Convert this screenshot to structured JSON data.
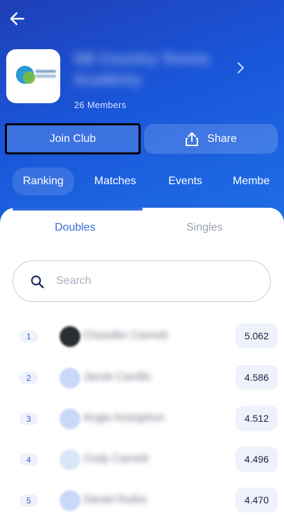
{
  "header": {
    "back_icon": "arrow-left-icon",
    "club_name": "SB Country Tennis Academy",
    "members_label": "26 Members",
    "chevron_icon": "chevron-right-icon"
  },
  "actions": {
    "join_label": "Join Club",
    "share_label": "Share",
    "share_icon": "share-upload-icon"
  },
  "tabs": [
    {
      "label": "Ranking",
      "active": true
    },
    {
      "label": "Matches",
      "active": false
    },
    {
      "label": "Events",
      "active": false
    },
    {
      "label": "Membe",
      "active": false
    }
  ],
  "subtabs": [
    {
      "label": "Doubles",
      "active": true
    },
    {
      "label": "Singles",
      "active": false
    }
  ],
  "search": {
    "placeholder": "Search",
    "icon": "search-icon"
  },
  "ranking": [
    {
      "rank": "1",
      "name": "Chandler Carnett",
      "score": "5.062"
    },
    {
      "rank": "2",
      "name": "Jacob Carrillo",
      "score": "4.586"
    },
    {
      "rank": "3",
      "name": "Angie Kreisphon",
      "score": "4.512"
    },
    {
      "rank": "4",
      "name": "Cody Carnett",
      "score": "4.496"
    },
    {
      "rank": "5",
      "name": "Daniel Rubio",
      "score": "4.470"
    }
  ],
  "colors": {
    "header_gradient_start": "#1f3fb8",
    "header_gradient_end": "#1f6fe6",
    "accent": "#2f6ae0",
    "active_subtab": "#3a6fd8",
    "inactive_subtab": "#9aa0b2"
  }
}
